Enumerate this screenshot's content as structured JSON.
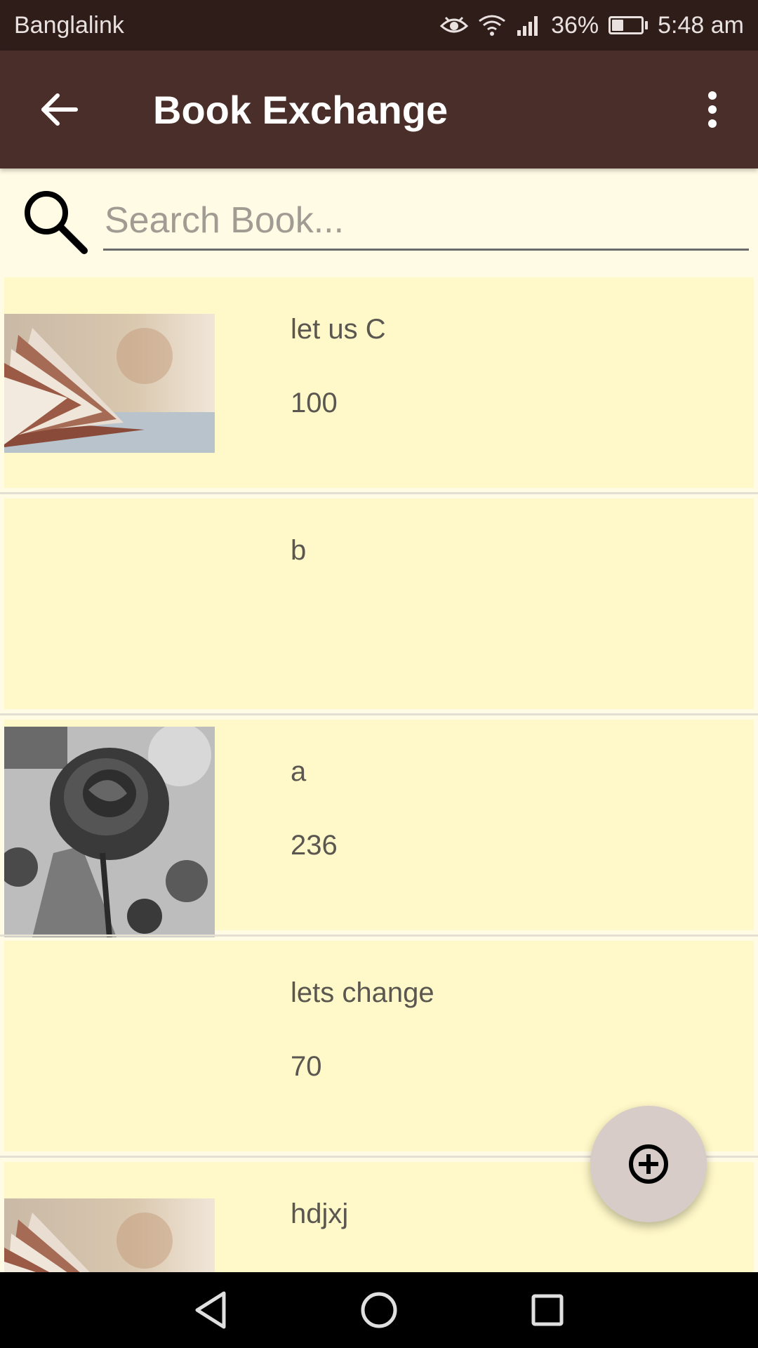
{
  "status_bar": {
    "carrier": "Banglalink",
    "battery_percent": "36%",
    "battery_level": 0.36,
    "time": "5:48 am",
    "icons": [
      "eye-icon",
      "wifi-icon",
      "signal-icon",
      "battery-icon"
    ]
  },
  "app_bar": {
    "title": "Book Exchange",
    "back_icon": "arrow-left-icon",
    "menu_icon": "more-vert-icon"
  },
  "search": {
    "placeholder": "Search Book...",
    "value": ""
  },
  "books": [
    {
      "title": "let us C",
      "price": "100",
      "image": "open-book-photo"
    },
    {
      "title": "b",
      "price": "",
      "image": ""
    },
    {
      "title": "a",
      "price": "236",
      "image": "rose-photo"
    },
    {
      "title": "lets change",
      "price": "70",
      "image": ""
    },
    {
      "title": "hdjxj",
      "price": "",
      "image": "open-book-photo"
    }
  ],
  "fab": {
    "icon": "add-circle-icon"
  },
  "nav_bar": {
    "icons": [
      "back-triangle-icon",
      "home-circle-icon",
      "recents-square-icon"
    ]
  },
  "colors": {
    "status_bar": "#2f1d1a",
    "app_bar": "#4a2e29",
    "background": "#fffbe5",
    "card": "#fff8c8",
    "fab": "#d7ccc8"
  }
}
